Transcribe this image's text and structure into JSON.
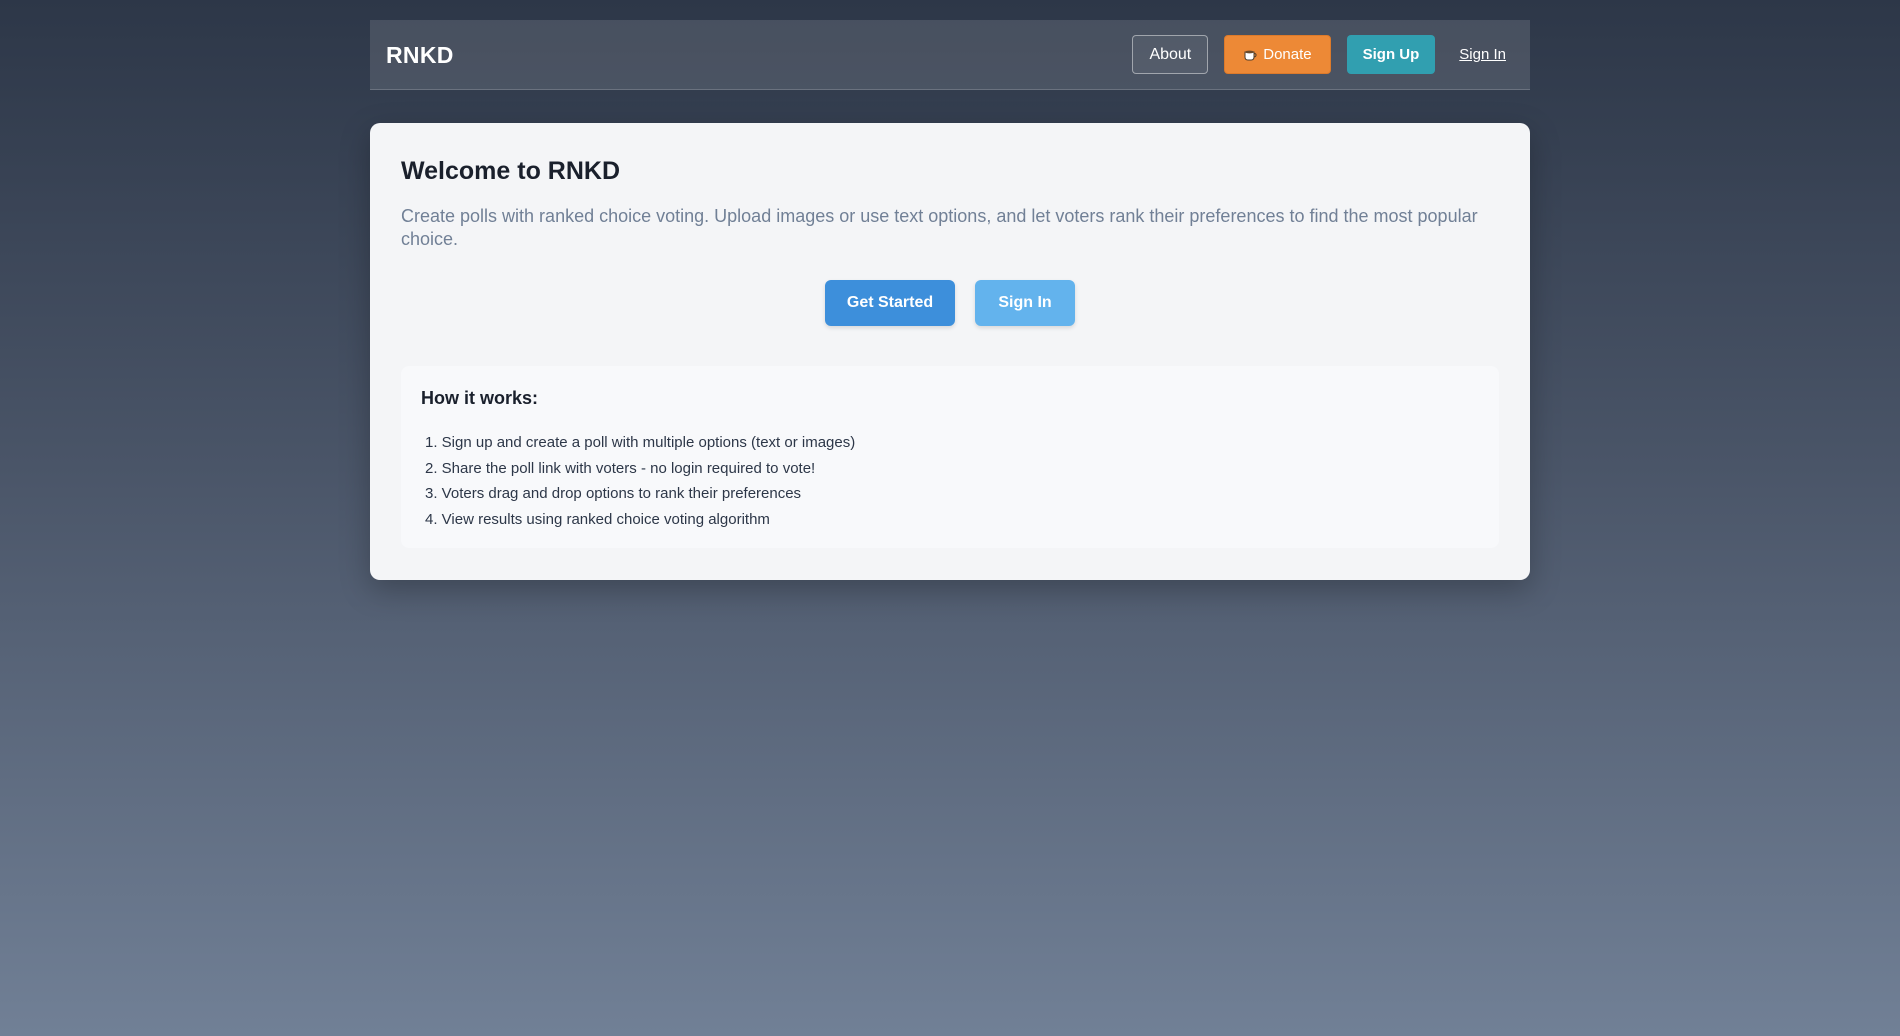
{
  "header": {
    "brand": "RNKD",
    "nav": {
      "about": "About",
      "donate": "Donate",
      "donate_icon": "coffee-cup-icon",
      "sign_up": "Sign Up",
      "sign_in": "Sign In"
    }
  },
  "colors": {
    "donate": "#ed8936",
    "sign_up": "#319fb0",
    "get_started": "#3d8fdb",
    "sign_in_secondary": "#63b3ed"
  },
  "main": {
    "title": "Welcome to RNKD",
    "intro": "Create polls with ranked choice voting. Upload images or use text options, and let voters rank their preferences to find the most popular choice.",
    "buttons": {
      "get_started": "Get Started",
      "sign_in": "Sign In"
    },
    "how_it_works": {
      "title": "How it works:",
      "steps": [
        "1. Sign up and create a poll with multiple options (text or images)",
        "2. Share the poll link with voters - no login required to vote!",
        "3. Voters drag and drop options to rank their preferences",
        "4. View results using ranked choice voting algorithm"
      ]
    }
  }
}
